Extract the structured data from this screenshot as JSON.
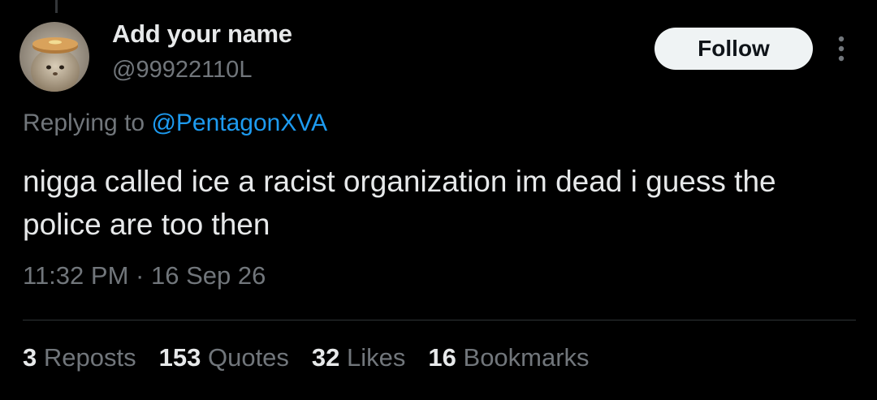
{
  "tweet": {
    "display_name": "Add your name",
    "handle": "@99922110L",
    "follow_label": "Follow",
    "replying_prefix": "Replying to",
    "replying_to": "@PentagonXVA",
    "text": "nigga called ice a racist organization im dead i guess the police are too then",
    "time": "11:32 PM",
    "separator": "·",
    "date": "16 Sep 26"
  },
  "stats": {
    "reposts_count": "3",
    "reposts_label": "Reposts",
    "quotes_count": "153",
    "quotes_label": "Quotes",
    "likes_count": "32",
    "likes_label": "Likes",
    "bookmarks_count": "16",
    "bookmarks_label": "Bookmarks"
  },
  "icons": {
    "more": "more-vertical-icon"
  },
  "colors": {
    "background": "#000000",
    "primary_text": "#e7e9ea",
    "secondary_text": "#71767b",
    "link": "#1d9bf0",
    "follow_bg": "#eff3f4",
    "divider": "#2f3336"
  }
}
